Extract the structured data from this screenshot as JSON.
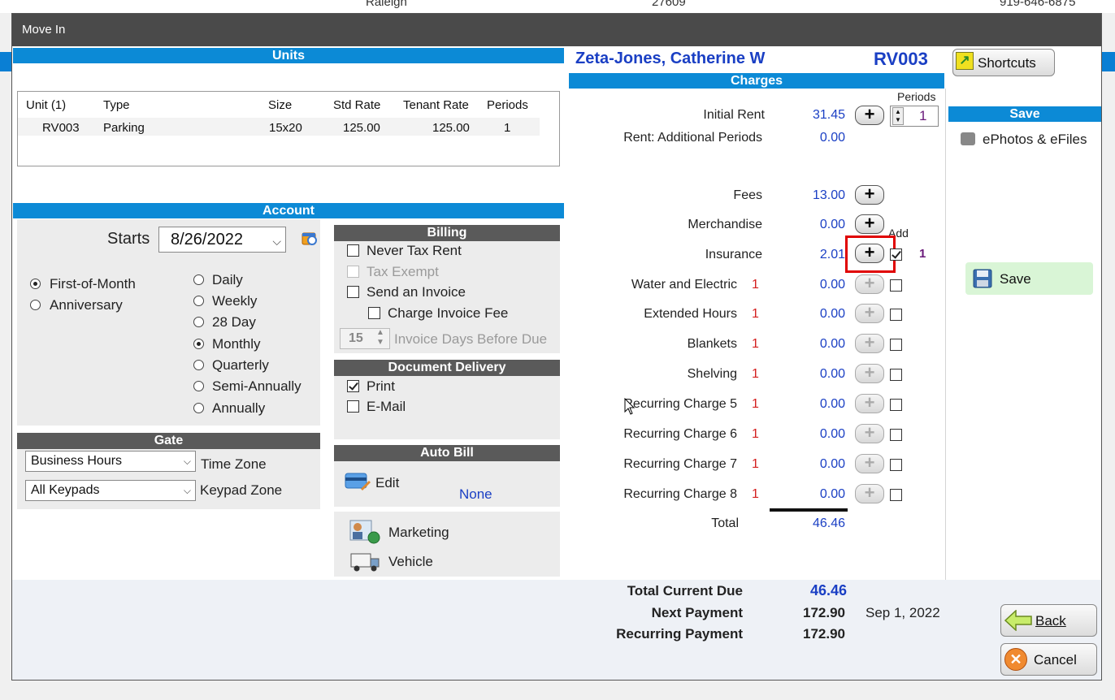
{
  "background_strip": {
    "city": "Raleigh",
    "zip": "27609",
    "phone": "919-646-6875"
  },
  "window_title": "Move In",
  "units": {
    "header": "Units",
    "columns": [
      "Unit (1)",
      "Type",
      "Size",
      "Std Rate",
      "Tenant Rate",
      "Periods"
    ],
    "rows": [
      {
        "unit": "RV003",
        "type": "Parking",
        "size": "15x20",
        "std_rate": "125.00",
        "tenant_rate": "125.00",
        "periods": "1"
      }
    ]
  },
  "account": {
    "header": "Account",
    "starts_label": "Starts",
    "starts_value": "8/26/2022",
    "anchor_options": [
      {
        "label": "First-of-Month",
        "selected": true
      },
      {
        "label": "Anniversary",
        "selected": false
      }
    ],
    "frequency_options": [
      {
        "label": "Daily",
        "selected": false
      },
      {
        "label": "Weekly",
        "selected": false
      },
      {
        "label": "28 Day",
        "selected": false
      },
      {
        "label": "Monthly",
        "selected": true
      },
      {
        "label": "Quarterly",
        "selected": false
      },
      {
        "label": "Semi-Annually",
        "selected": false
      },
      {
        "label": "Annually",
        "selected": false
      }
    ]
  },
  "billing": {
    "header": "Billing",
    "never_tax_rent": "Never Tax Rent",
    "tax_exempt": "Tax Exempt",
    "send_invoice": "Send an Invoice",
    "charge_invoice_fee": "Charge Invoice Fee",
    "invoice_days_value": "15",
    "invoice_days_label": "Invoice Days Before Due"
  },
  "document_delivery": {
    "header": "Document Delivery",
    "print": "Print",
    "email": "E-Mail"
  },
  "gate": {
    "header": "Gate",
    "time_zone_value": "Business Hours",
    "time_zone_label": "Time Zone",
    "keypad_zone_value": "All Keypads",
    "keypad_zone_label": "Keypad Zone"
  },
  "auto_bill": {
    "header": "Auto Bill",
    "edit": "Edit",
    "status": "None"
  },
  "extras": {
    "marketing": "Marketing",
    "vehicle": "Vehicle"
  },
  "tenant": {
    "name": "Zeta-Jones, Catherine W",
    "unit": "RV003"
  },
  "charges": {
    "header": "Charges",
    "periods_label": "Periods",
    "initial_rent": {
      "label": "Initial Rent",
      "amount": "31.45",
      "periods": "1"
    },
    "additional_periods": {
      "label": "Rent: Additional Periods",
      "amount": "0.00"
    },
    "fees": {
      "label": "Fees",
      "amount": "13.00"
    },
    "merchandise": {
      "label": "Merchandise",
      "amount": "0.00"
    },
    "add_label": "Add",
    "insurance": {
      "label": "Insurance",
      "amount": "2.01",
      "qty": "1"
    },
    "recurring": [
      {
        "label": "Water and Electric",
        "qty": "1",
        "amount": "0.00"
      },
      {
        "label": "Extended Hours",
        "qty": "1",
        "amount": "0.00"
      },
      {
        "label": "Blankets",
        "qty": "1",
        "amount": "0.00"
      },
      {
        "label": "Shelving",
        "qty": "1",
        "amount": "0.00"
      },
      {
        "label": "Recurring Charge 5",
        "qty": "1",
        "amount": "0.00"
      },
      {
        "label": "Recurring Charge 6",
        "qty": "1",
        "amount": "0.00"
      },
      {
        "label": "Recurring Charge 7",
        "qty": "1",
        "amount": "0.00"
      },
      {
        "label": "Recurring Charge 8",
        "qty": "1",
        "amount": "0.00"
      }
    ],
    "total_label": "Total",
    "total_value": "46.46"
  },
  "summary": {
    "total_current_due_label": "Total Current Due",
    "total_current_due": "46.46",
    "next_payment_label": "Next Payment",
    "next_payment": "172.90",
    "next_payment_date": "Sep 1, 2022",
    "recurring_payment_label": "Recurring Payment",
    "recurring_payment": "172.90"
  },
  "right_panel": {
    "shortcuts": "Shortcuts",
    "save_header": "Save",
    "ephotos": "ePhotos & eFiles",
    "save_button": "Save",
    "back": "Back",
    "cancel": "Cancel"
  },
  "colors": {
    "section_blue": "#0c8ad6",
    "title_gray": "#4a4a4a",
    "link_blue": "#1a3fc4",
    "highlight_red": "#e00000",
    "save_green": "#d9f5d6"
  }
}
